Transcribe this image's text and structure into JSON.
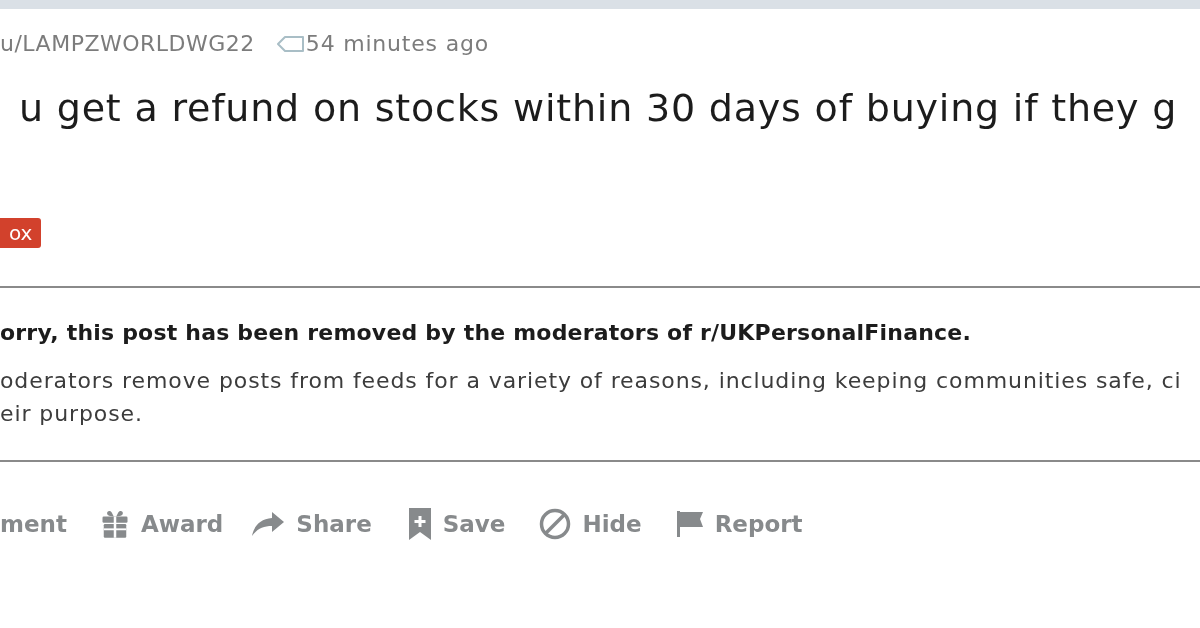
{
  "post": {
    "author": "u/LAMPZWORLDWG22",
    "time": "54 minutes ago",
    "title": "u get a refund on stocks within 30 days of buying if they g",
    "flair": "ox"
  },
  "removal_notice": {
    "heading": "orry, this post has been removed by the moderators of r/UKPersonalFinance.",
    "body_lines": [
      "oderators remove posts from feeds for a variety of reasons, including keeping communities safe, ci",
      "eir purpose."
    ]
  },
  "actions": [
    {
      "kind": "comment",
      "label": "ment"
    },
    {
      "kind": "award",
      "label": "Award"
    },
    {
      "kind": "share",
      "label": "Share"
    },
    {
      "kind": "save",
      "label": "Save"
    },
    {
      "kind": "hide",
      "label": "Hide"
    },
    {
      "kind": "report",
      "label": "Report"
    }
  ]
}
